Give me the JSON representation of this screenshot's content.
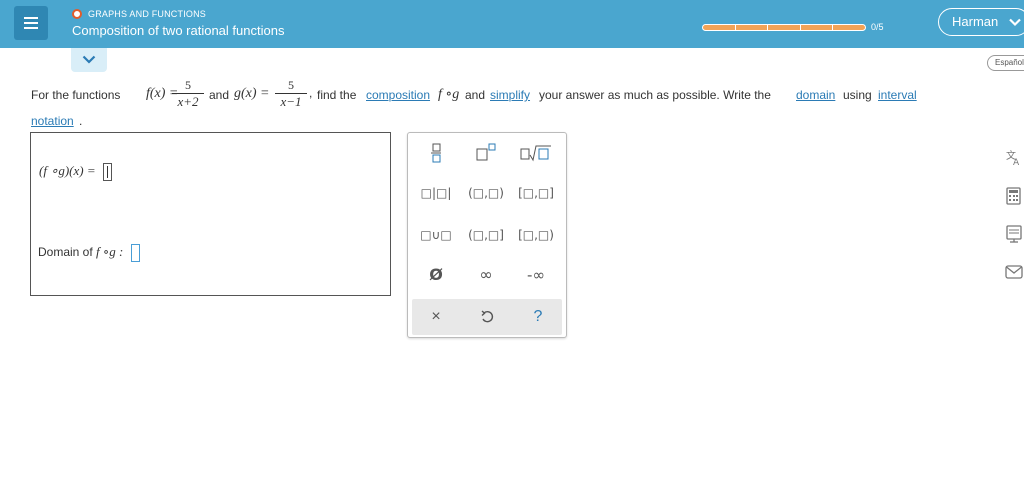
{
  "header": {
    "topic": "GRAPHS AND FUNCTIONS",
    "title": "Composition of two rational functions",
    "progress_label": "0/5",
    "progress_fraction": 0,
    "user": "Harman"
  },
  "language_button": "Español",
  "question": {
    "intro": "For the functions",
    "f_lhs": "f(x) =",
    "f_num": "5",
    "f_den": "x+2",
    "and": "and",
    "g_lhs": "g(x) =",
    "g_num": "5",
    "g_den": "x−1",
    "comma": ",",
    "find_the": "find the",
    "composition_link": "composition",
    "fog": "f ∘g",
    "and2": "and",
    "simplify_link": "simplify",
    "rest": "your answer as much as possible. Write the",
    "domain_link": "domain",
    "using": "using",
    "interval_link": "interval",
    "notation_link": "notation",
    "period": "."
  },
  "answer": {
    "line1_label": "(f ∘g)(x) =",
    "line2_label": "Domain of",
    "line2_func": "f ∘g :"
  },
  "keypad": {
    "fraction": "fraction",
    "superscript": "superscript",
    "sqrt": "square-root",
    "abs": "□|□|",
    "open_open": "(□,□)",
    "closed_closed": "[□,□]",
    "union": "□∪□",
    "open_closed": "(□,□]",
    "closed_open": "[□,□)",
    "empty_set": "Ø",
    "infinity": "∞",
    "neg_infinity": "-∞",
    "clear": "×",
    "undo": "↺",
    "help": "?"
  }
}
